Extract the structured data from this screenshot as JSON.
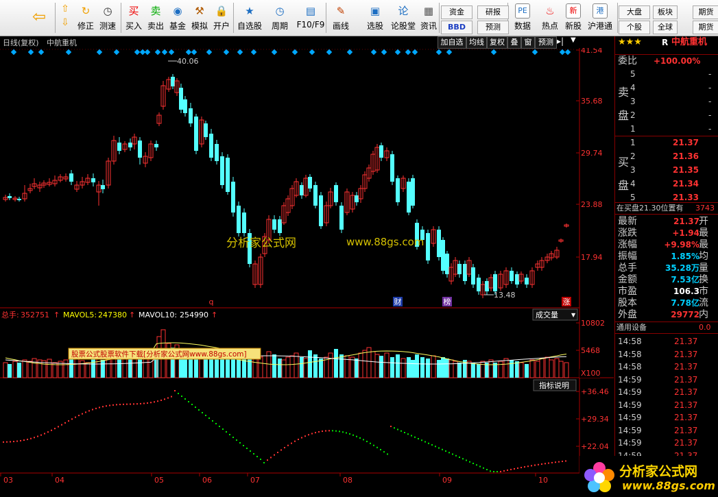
{
  "toolbar": {
    "buttons": [
      {
        "label": "修正",
        "icon": "refresh-icon"
      },
      {
        "label": "测速",
        "icon": "clock-icon"
      },
      {
        "label": "买入",
        "icon": "buy-icon"
      },
      {
        "label": "卖出",
        "icon": "sell-icon"
      },
      {
        "label": "基金",
        "icon": "fund-icon"
      },
      {
        "label": "模拟",
        "icon": "hammer-icon"
      },
      {
        "label": "开户",
        "icon": "lock-icon"
      },
      {
        "label": "自选股",
        "icon": "star-icon"
      },
      {
        "label": "周期",
        "icon": "clock-period-icon"
      },
      {
        "label": "F10/F9",
        "icon": "document-icon"
      },
      {
        "label": "画线",
        "icon": "pencil-icon"
      },
      {
        "label": "选股",
        "icon": "monitor-icon"
      },
      {
        "label": "论股堂",
        "icon": "discussion-icon"
      },
      {
        "label": "资讯",
        "icon": "news-icon"
      },
      {
        "label": "数据",
        "icon": "pe-icon"
      },
      {
        "label": "热点",
        "icon": "hot-icon"
      },
      {
        "label": "新股",
        "icon": "new-stock-icon"
      },
      {
        "label": "沪港通",
        "icon": "sse-hk-icon"
      }
    ],
    "small_buttons": [
      "资金",
      "研报",
      "BBD",
      "预测",
      "大盘",
      "板块",
      "期货",
      "个股",
      "全球",
      "期货"
    ]
  },
  "title_bar": {
    "label": "日线(复权)",
    "stock_name": "中航重机",
    "buttons": [
      "加自选",
      "均线",
      "复权",
      "叠",
      "窗",
      "预测"
    ]
  },
  "price_chart": {
    "y_labels": [
      "41.54",
      "35.68",
      "29.74",
      "23.88",
      "17.94"
    ],
    "high_label": "40.06",
    "low_label": "13.48",
    "markers": [
      "q",
      "财",
      "榜",
      "涨"
    ]
  },
  "watermark": {
    "left": "分析家公式网",
    "right": "www.88gs.com"
  },
  "volume": {
    "total_label": "总手:",
    "total_value": "352751",
    "mavol5_label": "MAVOL5:",
    "mavol5_value": "247380",
    "mavol10_label": "MAVOL10:",
    "mavol10_value": "254990",
    "dropdown": "成交量",
    "y_labels": [
      "10802",
      "5468"
    ],
    "unit": "X100",
    "ad_text": "股票公式股票软件下载[分析家公式网www.88gs.com]",
    "indicator_btn": "指标说明"
  },
  "indicator": {
    "y_labels": [
      "+36.46",
      "+29.34",
      "+22.04"
    ]
  },
  "x_axis": [
    "03",
    "04",
    "05",
    "06",
    "07",
    "08",
    "09",
    "10"
  ],
  "right_panel": {
    "stars": "★★★",
    "code_prefix": "R",
    "stock_name": "中航重机",
    "weibi_label": "委比",
    "weibi_value": "+100.00%",
    "sell_label_1": "卖",
    "sell_label_2": "盘",
    "buy_label_1": "买",
    "buy_label_2": "盘",
    "sell_rows": [
      {
        "n": "5",
        "price": "",
        "vol": ""
      },
      {
        "n": "4",
        "price": "",
        "vol": ""
      },
      {
        "n": "3",
        "price": "",
        "vol": ""
      },
      {
        "n": "2",
        "price": "",
        "vol": ""
      },
      {
        "n": "1",
        "price": "",
        "vol": ""
      }
    ],
    "buy_rows": [
      {
        "n": "1",
        "price": "21.37"
      },
      {
        "n": "2",
        "price": "21.36"
      },
      {
        "n": "3",
        "price": "21.35"
      },
      {
        "n": "4",
        "price": "21.34"
      },
      {
        "n": "5",
        "price": "21.33"
      }
    ],
    "notice": "在买盘21.30位置有",
    "notice_num": "3743",
    "quote": [
      {
        "label": "最新",
        "value": "21.37",
        "suffix": "开",
        "cls": "red"
      },
      {
        "label": "涨跌",
        "value": "+1.94",
        "suffix": "最",
        "cls": "red"
      },
      {
        "label": "涨幅",
        "value": "+9.98%",
        "suffix": "最",
        "cls": "red"
      },
      {
        "label": "振幅",
        "value": "1.85%",
        "suffix": "均",
        "cls": "cyan"
      },
      {
        "label": "总手",
        "value": "35.28万",
        "suffix": "量",
        "cls": "cyan"
      },
      {
        "label": "金额",
        "value": "7.53亿",
        "suffix": "换",
        "cls": "cyan"
      },
      {
        "label": "市盈",
        "value": "106.3",
        "suffix": "市",
        "cls": "white"
      },
      {
        "label": "股本",
        "value": "7.78亿",
        "suffix": "流",
        "cls": "cyan"
      },
      {
        "label": "外盘",
        "value": "29772",
        "suffix": "内",
        "cls": "red"
      }
    ],
    "sector_label": "通用设备",
    "sector_value": "0.0",
    "ticks": [
      {
        "time": "14:58",
        "price": "21.37"
      },
      {
        "time": "14:58",
        "price": "21.37"
      },
      {
        "time": "14:58",
        "price": "21.37"
      },
      {
        "time": "14:59",
        "price": "21.37"
      },
      {
        "time": "14:59",
        "price": "21.37"
      },
      {
        "time": "14:59",
        "price": "21.37"
      },
      {
        "time": "14:59",
        "price": "21.37"
      },
      {
        "time": "14:59",
        "price": "21.37"
      },
      {
        "time": "14:59",
        "price": "21.37"
      },
      {
        "time": "14:59",
        "price": "21.37"
      },
      {
        "time": "14:59",
        "price": "21.37"
      }
    ],
    "logo_text": "分析家公式网",
    "logo_url": "www.88gs.com"
  },
  "colors": {
    "up": "#ff3232",
    "down": "#54ffff",
    "axis": "#aa0000",
    "marker": "#00a8ff"
  }
}
